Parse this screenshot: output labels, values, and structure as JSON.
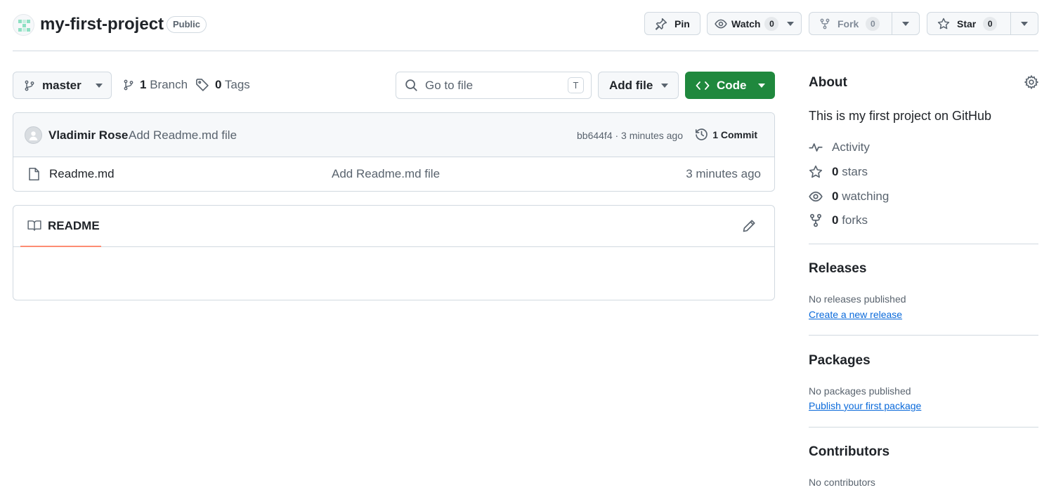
{
  "repo": {
    "name": "my-first-project",
    "visibility": "Public",
    "pin_label": "Pin",
    "watch_label": "Watch",
    "watch_count": "0",
    "fork_label": "Fork",
    "fork_count": "0",
    "star_label": "Star",
    "star_count": "0"
  },
  "toolbar": {
    "branch": "master",
    "branch_count": "1",
    "branch_word": "Branch",
    "tag_count": "0",
    "tag_word": "Tags",
    "goto_placeholder": "Go to file",
    "goto_shortcut": "T",
    "add_file_label": "Add file",
    "code_label": "Code"
  },
  "commit": {
    "author": "Vladimir Rose",
    "message": "Add Readme.md file",
    "hash_time": "bb644f4 · 3 minutes ago",
    "count_label": "1 Commit"
  },
  "files": [
    {
      "name": "Readme.md",
      "commit": "Add Readme.md file",
      "time": "3 minutes ago"
    }
  ],
  "readme": {
    "tab_label": "README"
  },
  "sidebar": {
    "about_title": "About",
    "description": "This is my first project on GitHub",
    "activity_label": "Activity",
    "stars_count": "0",
    "stars_word": "stars",
    "watching_count": "0",
    "watching_word": "watching",
    "forks_count": "0",
    "forks_word": "forks",
    "releases_title": "Releases",
    "releases_note": "No releases published",
    "releases_link": "Create a new release",
    "packages_title": "Packages",
    "packages_note": "No packages published",
    "packages_link": "Publish your first package",
    "contributors_title": "Contributors",
    "contributors_note": "No contributors"
  },
  "colors": {
    "primary_green": "#1f883d",
    "link_blue": "#0969da",
    "border": "#d1d9e0",
    "muted_text": "#59636e",
    "tab_underline": "#fd8c73"
  }
}
